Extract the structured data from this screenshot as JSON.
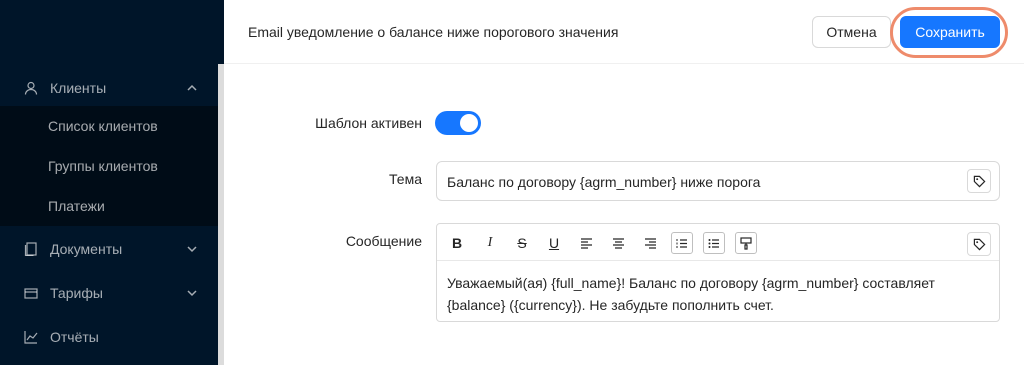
{
  "sidebar": {
    "menu": [
      {
        "label": "Клиенты",
        "icon": "user-icon",
        "expanded": true
      },
      {
        "label": "Документы",
        "icon": "document-icon"
      },
      {
        "label": "Тарифы",
        "icon": "tariff-icon"
      },
      {
        "label": "Отчёты",
        "icon": "chart-icon"
      }
    ],
    "submenu": [
      {
        "label": "Список клиентов"
      },
      {
        "label": "Группы клиентов"
      },
      {
        "label": "Платежи"
      }
    ]
  },
  "header": {
    "title": "Email уведомление о балансе ниже порогового значения",
    "cancel_label": "Отмена",
    "save_label": "Сохранить"
  },
  "form": {
    "active_label": "Шаблон активен",
    "active": true,
    "subject_label": "Тема",
    "subject_value": "Баланс по договору {agrm_number} ниже порога",
    "message_label": "Сообщение",
    "message_value": "Уважаемый(ая) {full_name}! Баланс по договору {agrm_number} составляет {balance} ({currency}). Не забудьте пополнить счет.",
    "toolbar": {
      "bold": "B",
      "italic": "I",
      "strike": "S",
      "underline": "U"
    }
  },
  "colors": {
    "sidebar_bg": "#001529",
    "submenu_bg": "#000c17",
    "primary": "#1677ff",
    "highlight": "#ee8b6b"
  }
}
